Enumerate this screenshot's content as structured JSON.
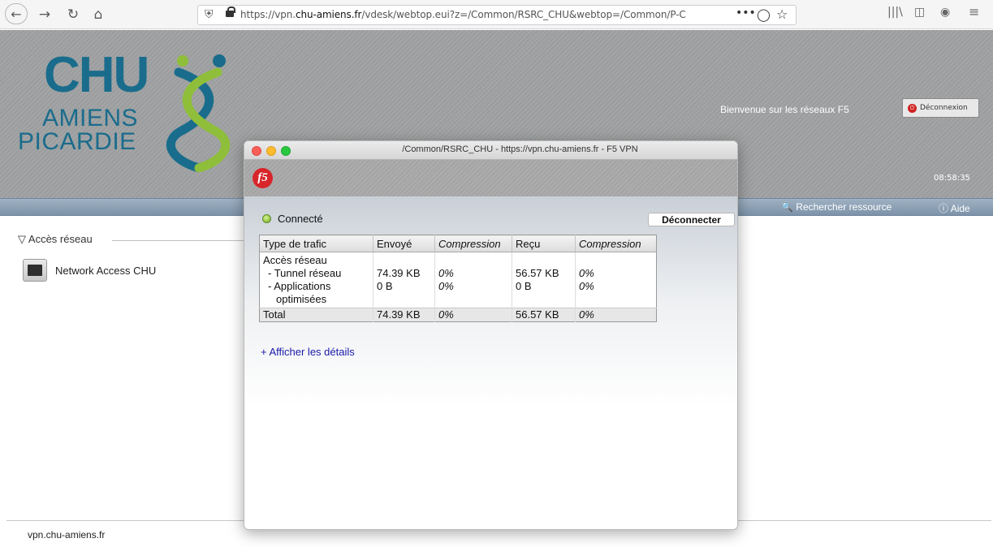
{
  "browser": {
    "url_prefix": "https://vpn.",
    "url_domain": "chu-amiens.fr",
    "url_rest": "/vdesk/webtop.eui?z=/Common/RSRC_CHU&webtop=/Common/P-C",
    "menu_dots": "•••"
  },
  "header": {
    "logo_line1": "CHU",
    "logo_line2": "AMIENS",
    "logo_line3": "PICARDIE",
    "welcome": "Bienvenue sur les réseaux F5",
    "logout_label": "Déconnexion",
    "clock": "08:58:35"
  },
  "navbar": {
    "search_label": "Rechercher ressource",
    "help_label": "Aide"
  },
  "content": {
    "section_title": "Accès réseau",
    "resource_label": "Network Access CHU"
  },
  "status_bar": {
    "text": "vpn.chu-amiens.fr"
  },
  "vpn_window": {
    "title": "/Common/RSRC_CHU - https://vpn.chu-amiens.fr - F5 VPN",
    "logo": "f5",
    "status": "Connecté",
    "disconnect_label": "Déconnecter",
    "table": {
      "headers": [
        "Type de trafic",
        "Envoyé",
        "Compression",
        "Reçu",
        "Compression"
      ],
      "group_label": "Accès réseau",
      "rows": [
        {
          "type": "- Tunnel réseau",
          "sent": "74.39 KB",
          "sent_comp": "0%",
          "recv": "56.57 KB",
          "recv_comp": "0%"
        },
        {
          "type": "- Applications",
          "type2": "optimisées",
          "sent": "0 B",
          "sent_comp": "0%",
          "recv": "0 B",
          "recv_comp": "0%"
        }
      ],
      "total": {
        "type": "Total",
        "sent": "74.39 KB",
        "sent_comp": "0%",
        "recv": "56.57 KB",
        "recv_comp": "0%"
      }
    },
    "details_link": "+ Afficher les détails"
  },
  "colors": {
    "logo_blue": "#1a6c8c",
    "f5_red": "#d8252a",
    "link_blue": "#1a1aa8",
    "connected_green": "#6fa621"
  }
}
